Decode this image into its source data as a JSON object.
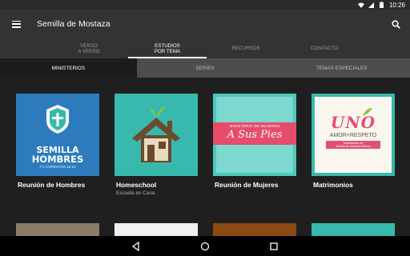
{
  "status": {
    "time": "10:26"
  },
  "app": {
    "title": "Semilla de Mostaza"
  },
  "tabs": [
    {
      "line1": "VERSO",
      "line2": "A VERSO",
      "active": false
    },
    {
      "line1": "ESTUDIOS",
      "line2": "POR TEMA",
      "active": true
    },
    {
      "line1": "RECURSOS",
      "line2": "",
      "active": false
    },
    {
      "line1": "CONTACTO",
      "line2": "",
      "active": false
    }
  ],
  "subtabs": [
    {
      "label": "MINISTERIOS",
      "active": true
    },
    {
      "label": "SERIES",
      "active": false
    },
    {
      "label": "TEMAS ESPECIALES",
      "active": false
    }
  ],
  "cards": [
    {
      "title": "Reunión de Hombres",
      "subtitle": "",
      "art": {
        "brand": "SEMILLA",
        "brand2": "HOMBRES",
        "verse": "// 1 CORINTIOS 16:13"
      }
    },
    {
      "title": "Homeschool",
      "subtitle": "Escuela en Casa"
    },
    {
      "title": "Reunión de Mujeres",
      "subtitle": "",
      "art": {
        "top": "MINISTERIO DE MUJERES",
        "script": "A Sus Pies"
      }
    },
    {
      "title": "Matrimonios",
      "subtitle": "",
      "art": {
        "uno": "UNO",
        "tagline": "AMOR+RESPETO",
        "line1": "Matrimonios de",
        "line2": "Semilla de Mostaza México"
      }
    }
  ],
  "colors": {
    "appbar": "#333333",
    "content": "#1f1f1f",
    "accent_teal": "#37b9ad",
    "men_blue": "#2d7bbd"
  }
}
